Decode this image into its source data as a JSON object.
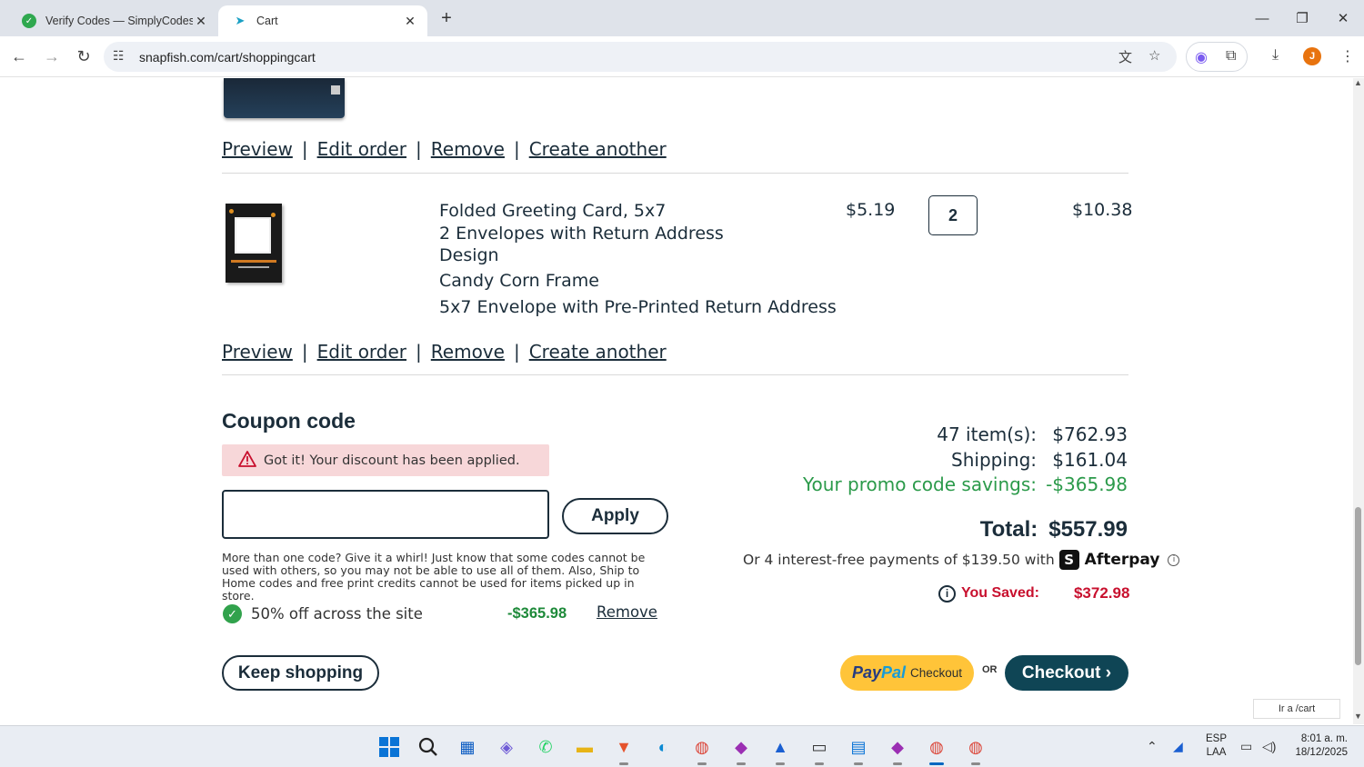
{
  "browser": {
    "tabs": [
      {
        "title": "Verify Codes — SimplyCodes",
        "icon": "simplycodes-icon"
      },
      {
        "title": "Cart",
        "icon": "snapfish-icon"
      }
    ],
    "url": "snapfish.com/cart/shoppingcart"
  },
  "cart": {
    "links": {
      "preview": "Preview",
      "edit": "Edit order",
      "remove": "Remove",
      "create": "Create another",
      "sep": "|"
    },
    "item": {
      "name": "Folded Greeting Card, 5x7",
      "line2": "2 Envelopes with Return Address",
      "line3": "Design",
      "line4": "Candy Corn Frame",
      "line5": "5x7 Envelope with Pre-Printed Return Address",
      "price": "$5.19",
      "quantity": "2",
      "total": "$10.38"
    }
  },
  "coupon": {
    "heading": "Coupon code",
    "alert": "Got it! Your discount has been applied.",
    "input_value": "",
    "apply_label": "Apply",
    "note": "More than one code? Give it a whirl! Just know that some codes cannot be used with others, so you may not be able to use all of them. Also, Ship to Home codes and free print credits cannot be used for items picked up in store.",
    "applied": {
      "label": "50% off across the site",
      "amount": "-$365.98",
      "remove": "Remove"
    }
  },
  "summary": {
    "items_label": "47 item(s):",
    "items_value": "$762.93",
    "shipping_label": "Shipping:",
    "shipping_value": "$161.04",
    "promo_label": "Your promo code savings:",
    "promo_value": "-$365.98",
    "total_label": "Total:",
    "total_value": "$557.99",
    "afterpay_text": "Or 4 interest-free payments of $139.50 with",
    "afterpay_brand": "Afterpay",
    "afterpay_logo": "S",
    "saved_label": "You Saved:",
    "saved_value": "$372.98"
  },
  "buttons": {
    "keep_shopping": "Keep shopping",
    "paypal_1": "Pay",
    "paypal_2": "Pal",
    "paypal_checkout": "Checkout",
    "or": "OR",
    "checkout": "Checkout ›"
  },
  "status_link": "Ir a /cart",
  "taskbar": {
    "lang_1": "ESP",
    "lang_2": "LAA",
    "time": "8:01 a. m.",
    "date": "18/12/2025"
  },
  "colors": {
    "brand_dark": "#0f4555",
    "promo_green": "#2b9a4a",
    "saved_red": "#c8102e",
    "paypal_yellow": "#ffc439"
  }
}
